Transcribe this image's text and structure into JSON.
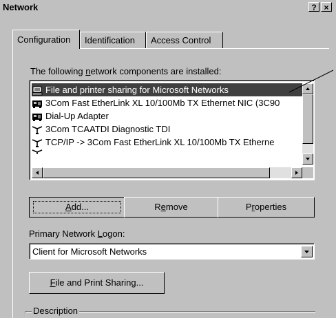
{
  "window": {
    "title": "Network",
    "help_label": "?",
    "close_label": "×"
  },
  "tabs": [
    {
      "label": "Configuration",
      "active": true
    },
    {
      "label": "Identification",
      "active": false
    },
    {
      "label": "Access Control",
      "active": false
    }
  ],
  "components": {
    "label_pre": "The following ",
    "label_underlined": "n",
    "label_post": "etwork components are installed:",
    "items": [
      {
        "icon": "sharing-service-icon",
        "label": "File and printer sharing for Microsoft Networks",
        "selected": true
      },
      {
        "icon": "network-adapter-icon",
        "label": "3Com Fast EtherLink XL 10/100Mb TX Ethernet NIC (3C90",
        "selected": false
      },
      {
        "icon": "network-adapter-icon",
        "label": "Dial-Up Adapter",
        "selected": false
      },
      {
        "icon": "protocol-icon",
        "label": "3Com TCAATDI Diagnostic TDI",
        "selected": false
      },
      {
        "icon": "protocol-icon",
        "label": "TCP/IP -> 3Com Fast EtherLink XL 10/100Mb TX Etherne",
        "selected": false
      }
    ]
  },
  "buttons": {
    "add": {
      "underlined": "A",
      "rest": "dd..."
    },
    "remove": {
      "pre": "R",
      "underlined": "e",
      "rest": "move"
    },
    "properties": {
      "pre": "P",
      "underlined": "r",
      "rest": "operties"
    }
  },
  "logon": {
    "label_pre": "Primary Network ",
    "label_underlined": "L",
    "label_post": "ogon:",
    "value": "Client for Microsoft Networks"
  },
  "file_print_sharing": {
    "underlined": "F",
    "rest": "ile and Print Sharing..."
  },
  "description": {
    "label": "Description"
  },
  "colors": {
    "face": "#c0c0c0",
    "selection": "#404040",
    "highlight": "#ffffff",
    "shadow": "#808080"
  }
}
